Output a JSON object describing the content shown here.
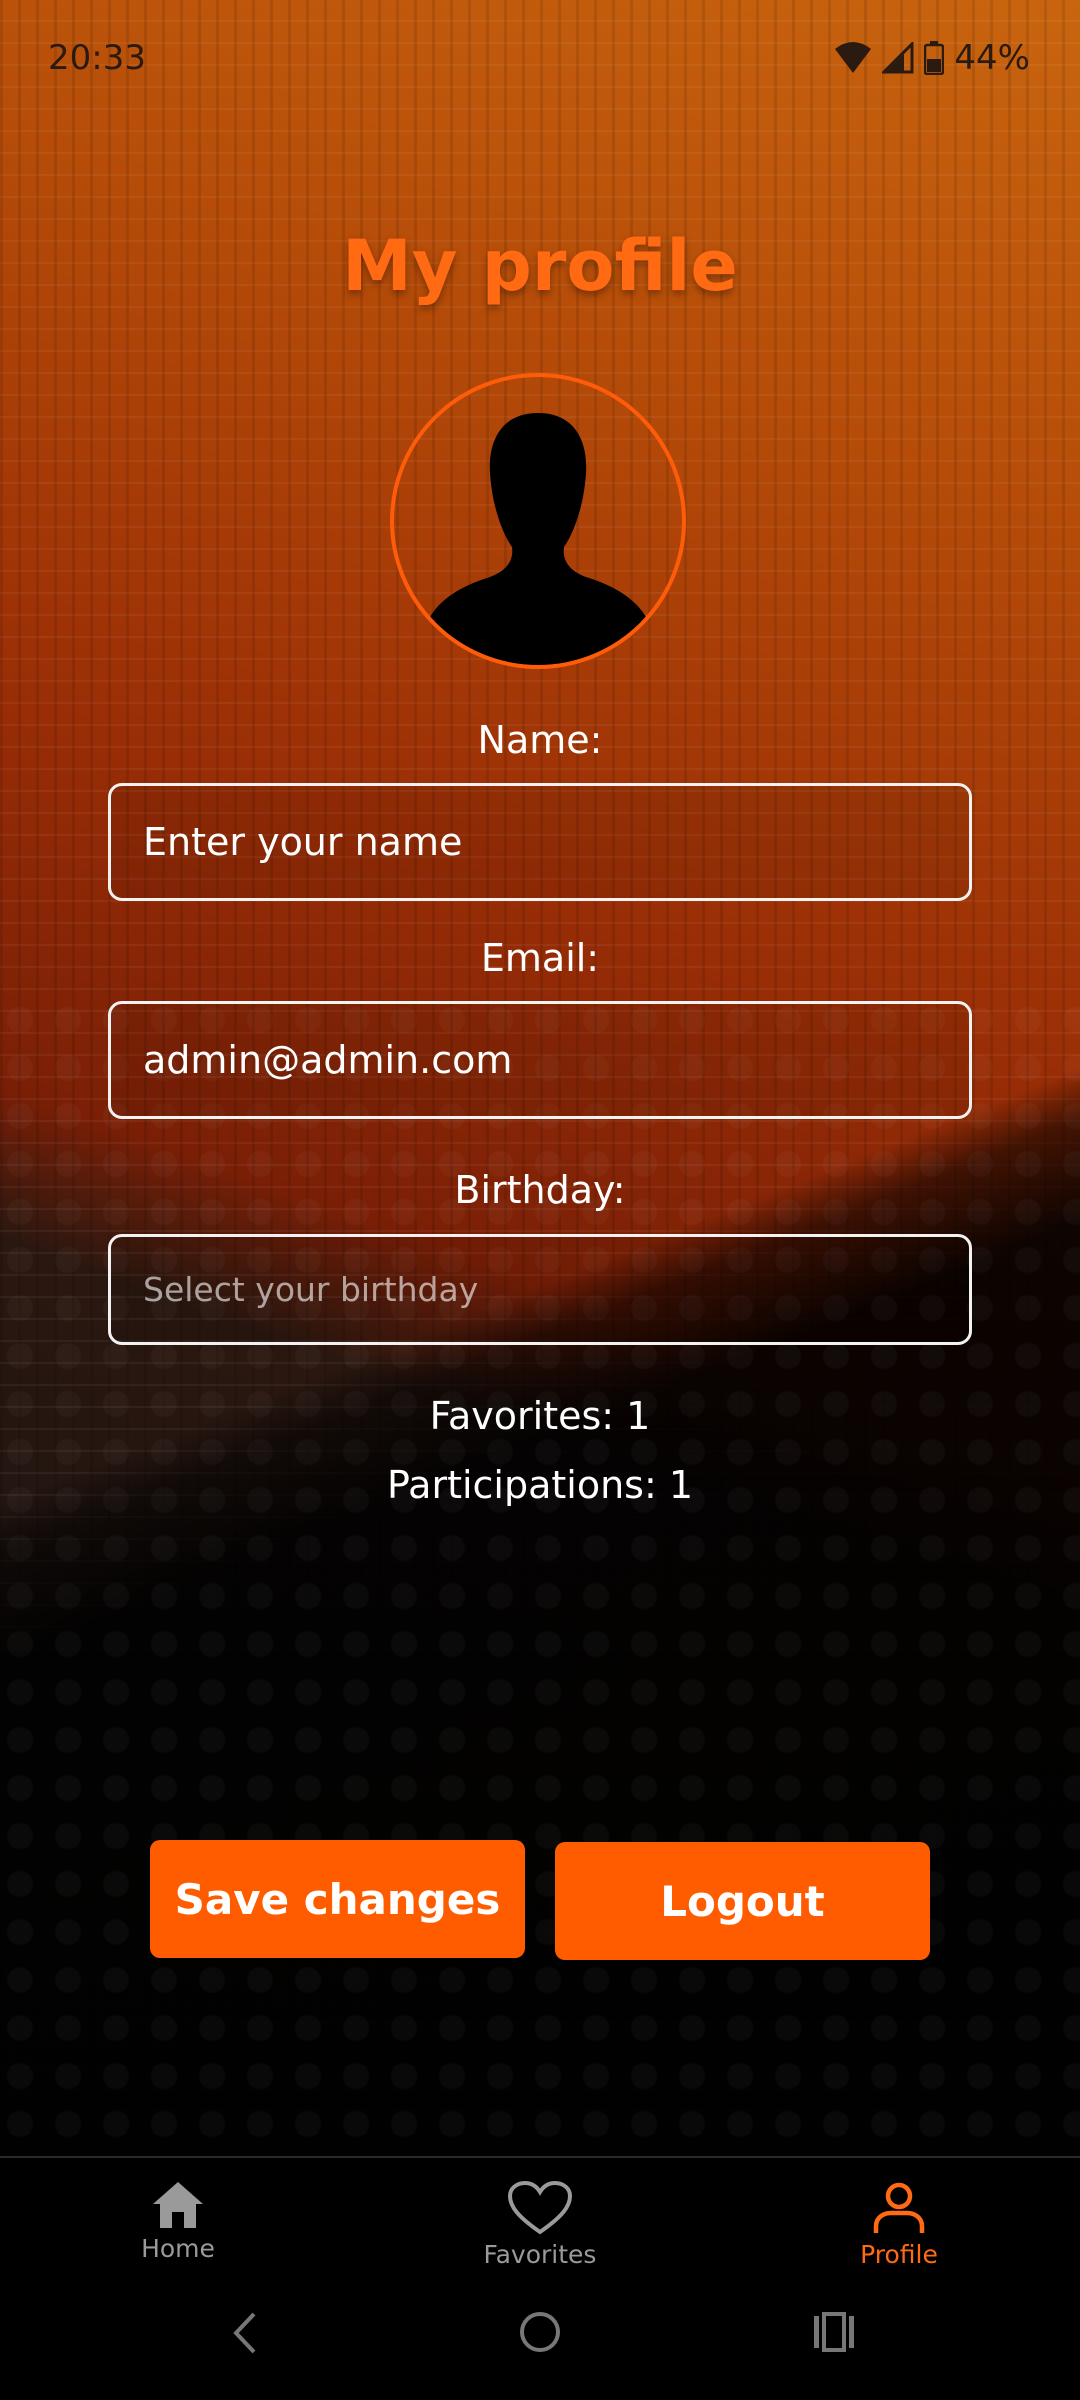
{
  "status_bar": {
    "time": "20:33",
    "battery": "44%",
    "icons": [
      "wifi-icon",
      "signal-icon",
      "battery-icon"
    ]
  },
  "page": {
    "title": "My profile"
  },
  "avatar": {
    "icon": "person-silhouette-icon",
    "border_color": "#ff5c0a"
  },
  "form": {
    "name_label": "Name:",
    "name_placeholder": "Enter your name",
    "name_value": "",
    "email_label": "Email:",
    "email_value": "admin@admin.com",
    "birthday_label": "Birthday:",
    "birthday_placeholder": "Select your birthday"
  },
  "stats": {
    "favorites": "Favorites: 1",
    "participations": "Participations: 1"
  },
  "actions": {
    "save_label": "Save changes",
    "logout_label": "Logout"
  },
  "bottom_nav": {
    "items": [
      {
        "label": "Home",
        "icon": "home-icon",
        "active": false
      },
      {
        "label": "Favorites",
        "icon": "heart-icon",
        "active": false
      },
      {
        "label": "Profile",
        "icon": "person-icon",
        "active": true
      }
    ]
  },
  "colors": {
    "accent": "#ff5c00",
    "title": "#ff6a13",
    "active_nav": "#ff6a13",
    "inactive_nav": "#9a9a9a"
  }
}
